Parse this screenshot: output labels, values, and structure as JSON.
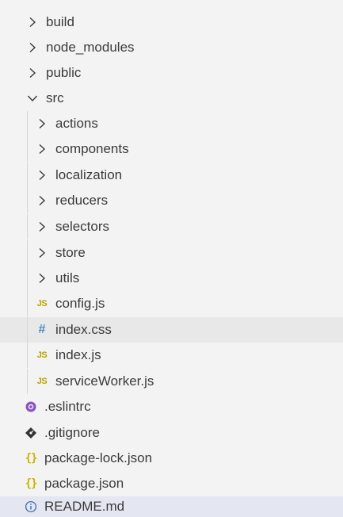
{
  "explorer": {
    "items": [
      {
        "label": "build",
        "kind": "folder",
        "expanded": false,
        "depth": 0,
        "icon": "chevron-right-icon"
      },
      {
        "label": "node_modules",
        "kind": "folder",
        "expanded": false,
        "depth": 0,
        "icon": "chevron-right-icon"
      },
      {
        "label": "public",
        "kind": "folder",
        "expanded": false,
        "depth": 0,
        "icon": "chevron-right-icon"
      },
      {
        "label": "src",
        "kind": "folder",
        "expanded": true,
        "depth": 0,
        "icon": "chevron-down-icon"
      },
      {
        "label": "actions",
        "kind": "folder",
        "expanded": false,
        "depth": 1,
        "icon": "chevron-right-icon"
      },
      {
        "label": "components",
        "kind": "folder",
        "expanded": false,
        "depth": 1,
        "icon": "chevron-right-icon"
      },
      {
        "label": "localization",
        "kind": "folder",
        "expanded": false,
        "depth": 1,
        "icon": "chevron-right-icon"
      },
      {
        "label": "reducers",
        "kind": "folder",
        "expanded": false,
        "depth": 1,
        "icon": "chevron-right-icon"
      },
      {
        "label": "selectors",
        "kind": "folder",
        "expanded": false,
        "depth": 1,
        "icon": "chevron-right-icon"
      },
      {
        "label": "store",
        "kind": "folder",
        "expanded": false,
        "depth": 1,
        "icon": "chevron-right-icon"
      },
      {
        "label": "utils",
        "kind": "folder",
        "expanded": false,
        "depth": 1,
        "icon": "chevron-right-icon"
      },
      {
        "label": "config.js",
        "kind": "file",
        "depth": 1,
        "icon": "javascript-file-icon",
        "glyph": "JS"
      },
      {
        "label": "index.css",
        "kind": "file",
        "depth": 1,
        "icon": "css-file-icon",
        "glyph": "#",
        "state": "hover"
      },
      {
        "label": "index.js",
        "kind": "file",
        "depth": 1,
        "icon": "javascript-file-icon",
        "glyph": "JS"
      },
      {
        "label": "serviceWorker.js",
        "kind": "file",
        "depth": 1,
        "icon": "javascript-file-icon",
        "glyph": "JS"
      },
      {
        "label": ".eslintrc",
        "kind": "file",
        "depth": 0,
        "icon": "eslint-file-icon"
      },
      {
        "label": ".gitignore",
        "kind": "file",
        "depth": 0,
        "icon": "git-file-icon"
      },
      {
        "label": "package-lock.json",
        "kind": "file",
        "depth": 0,
        "icon": "json-file-icon",
        "glyph": "{}"
      },
      {
        "label": "package.json",
        "kind": "file",
        "depth": 0,
        "icon": "json-file-icon",
        "glyph": "{}"
      },
      {
        "label": "README.md",
        "kind": "file",
        "depth": 0,
        "icon": "info-file-icon",
        "state": "selected"
      }
    ]
  },
  "colors": {
    "background": "#f3f3f3",
    "text": "#3b3b3b",
    "selected_row": "#e4e6f1",
    "hover_row": "#e8e8e8",
    "js_icon": "#b7a400",
    "css_icon": "#4a8bc2",
    "json_icon": "#cbb300",
    "eslint_icon": "#8a53c6",
    "git_icon": "#333333",
    "info_icon": "#3c6fb5"
  }
}
